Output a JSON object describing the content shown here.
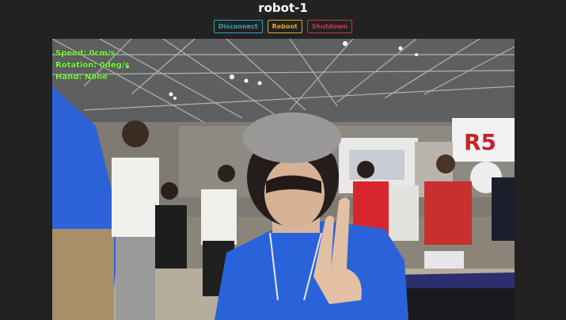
{
  "header": {
    "title": "robot-1"
  },
  "controls": {
    "disconnect_label": "Disconnect",
    "reboot_label": "Reboot",
    "shutdown_label": "Shutdown"
  },
  "telemetry": {
    "speed": "Speed: 0cm/s",
    "rotation": "Rotation: 0deg/s",
    "hand": "Hand: None"
  },
  "feed": {
    "booth_sign": "R5"
  },
  "colors": {
    "telemetry_text": "#7dff3a",
    "disconnect": "#2fa4b8",
    "reboot": "#e0a428",
    "shutdown": "#c83a44"
  }
}
